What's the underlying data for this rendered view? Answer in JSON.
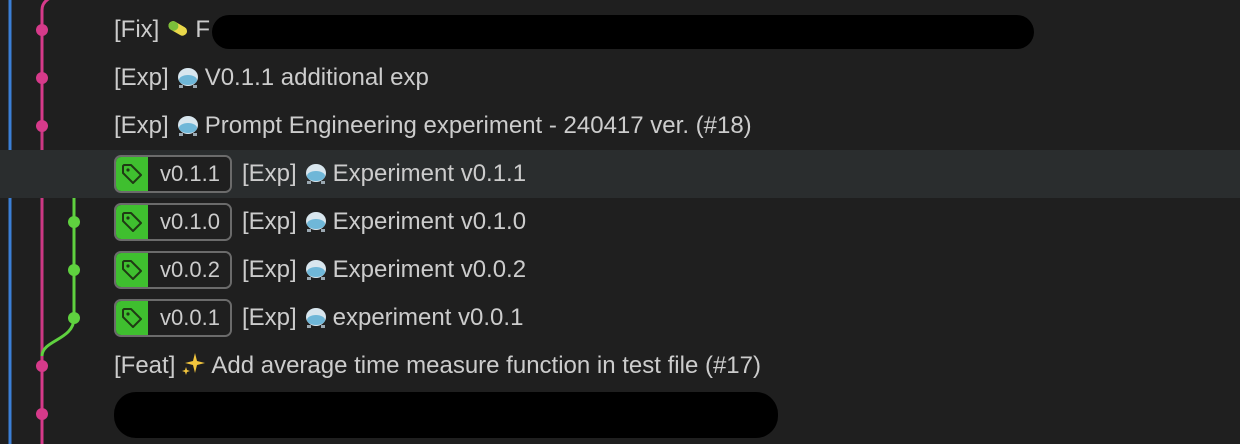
{
  "commits": [
    {
      "type_label": "[Fix]",
      "icon": "pill-icon",
      "message": "F",
      "redacted": true
    },
    {
      "type_label": "[Exp]",
      "icon": "alembic-icon",
      "message": "V0.1.1 additional exp"
    },
    {
      "type_label": "[Exp]",
      "icon": "alembic-icon",
      "message": "Prompt Engineering experiment - 240417 ver. (#18)"
    },
    {
      "type_label": "[Exp]",
      "icon": "alembic-icon",
      "message": "Experiment v0.1.1",
      "tag": "v0.1.1",
      "hovered": true
    },
    {
      "type_label": "[Exp]",
      "icon": "alembic-icon",
      "message": "Experiment v0.1.0",
      "tag": "v0.1.0"
    },
    {
      "type_label": "[Exp]",
      "icon": "alembic-icon",
      "message": "Experiment v0.0.2",
      "tag": "v0.0.2"
    },
    {
      "type_label": "[Exp]",
      "icon": "alembic-icon",
      "message": "experiment v0.0.1",
      "tag": "v0.0.1"
    },
    {
      "type_label": "[Feat]",
      "icon": "sparkles-icon",
      "message": "Add average time measure function in test file (#17)"
    },
    {
      "type_label": "",
      "icon": "",
      "message": "",
      "redacted": true
    }
  ],
  "colors": {
    "background": "#1f1f1f",
    "hover_row": "#2a2d2e",
    "branch_main": "#d63a8a",
    "branch_tag": "#5fd13f",
    "branch_left": "#3b7fd6",
    "tag_badge": "#3fbf2f",
    "text": "#cccccc"
  }
}
